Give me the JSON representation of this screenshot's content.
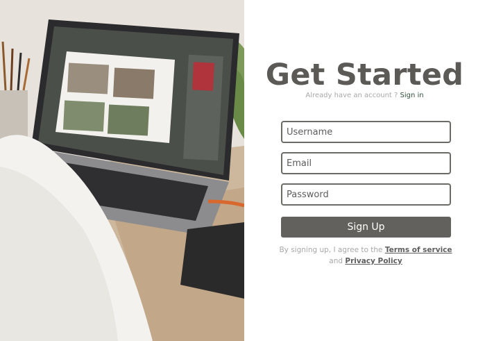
{
  "photo": {
    "alt_icon": "laptop-photo"
  },
  "form": {
    "title": "Get Started",
    "already_text": "Already have an account ?",
    "signin_label": "Sign in",
    "username_placeholder": "Username",
    "email_placeholder": "Email",
    "password_placeholder": "Password",
    "signup_label": "Sign Up",
    "terms_prefix": "By signing up, I agree to the",
    "terms_link": "Terms of service",
    "terms_and": "and",
    "privacy_link": "Privacy Policy"
  },
  "colors": {
    "title": "#5b5a57",
    "button": "#62615d",
    "field_border": "#6b6a67"
  }
}
